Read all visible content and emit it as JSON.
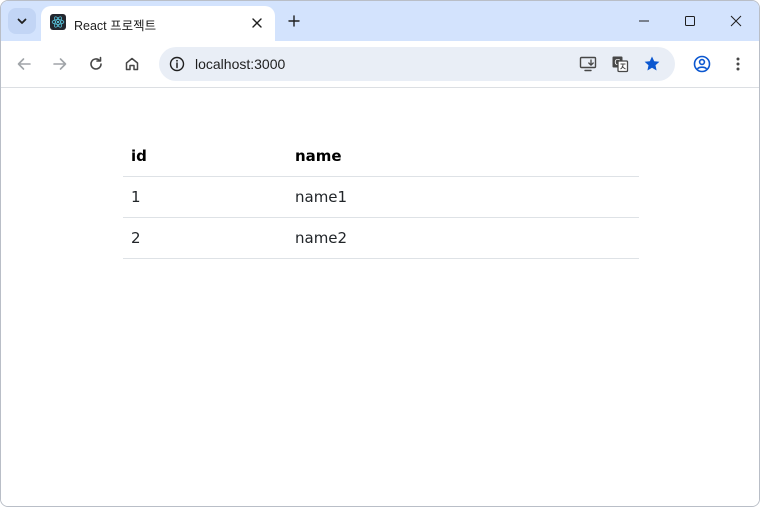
{
  "browser": {
    "tab": {
      "title": "React 프로젝트"
    },
    "address_bar": {
      "url": "localhost:3000"
    },
    "accent_color": "#0b57d0",
    "tabstrip_color": "#d3e3fd"
  },
  "page": {
    "table": {
      "headers": [
        "id",
        "name"
      ],
      "rows": [
        [
          "1",
          "name1"
        ],
        [
          "2",
          "name2"
        ]
      ]
    }
  }
}
